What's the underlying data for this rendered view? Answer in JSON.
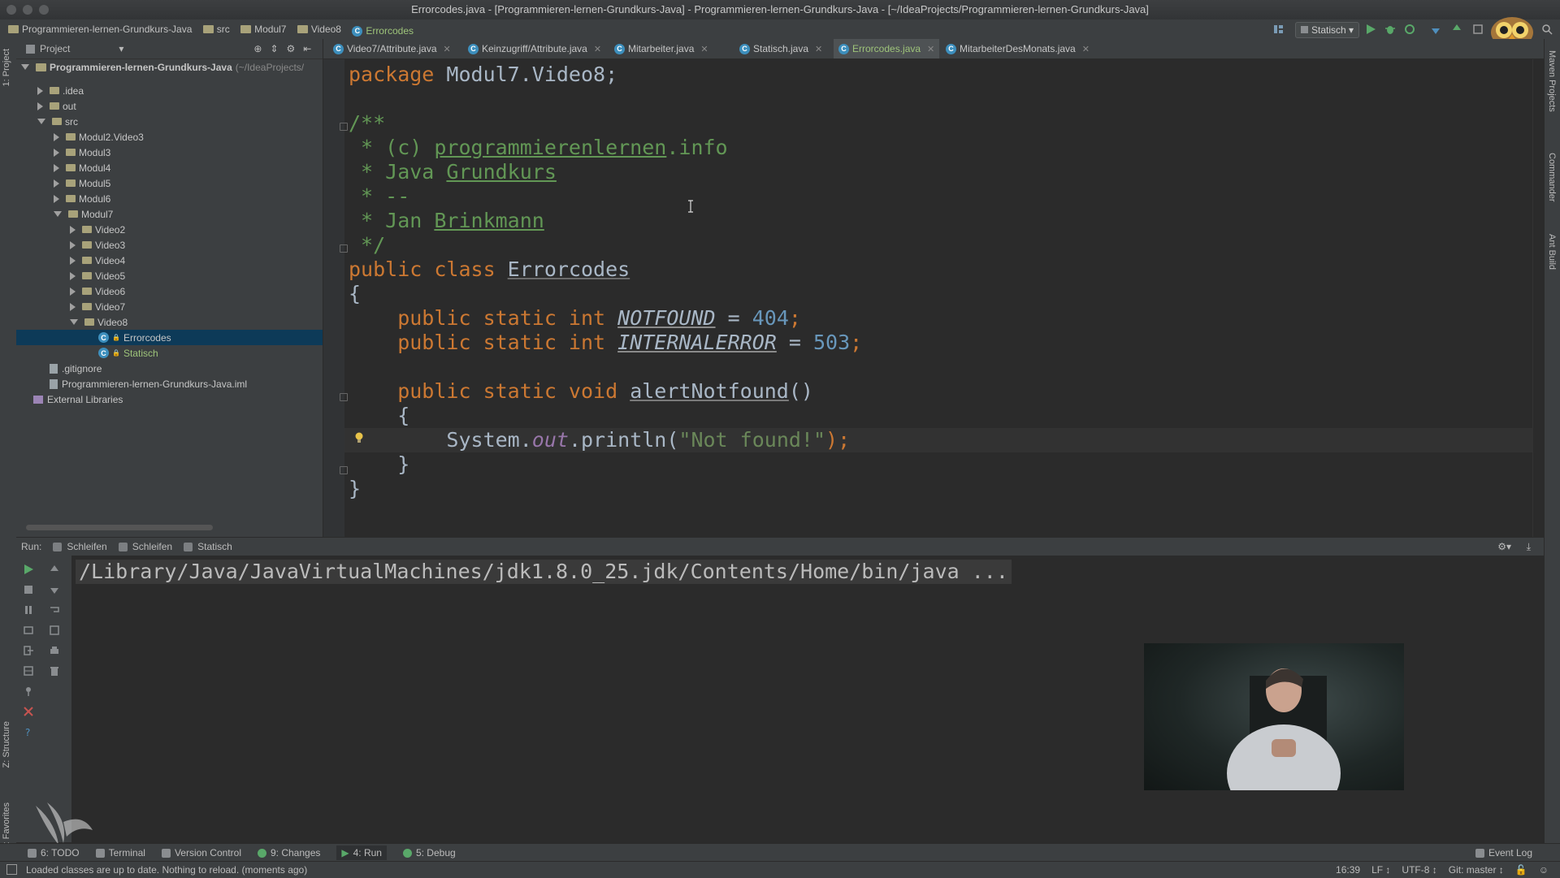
{
  "window": {
    "title": "Errorcodes.java - [Programmieren-lernen-Grundkurs-Java] - Programmieren-lernen-Grundkurs-Java - [~/IdeaProjects/Programmieren-lernen-Grundkurs-Java]"
  },
  "navbar": {
    "crumbs": [
      "Programmieren-lernen-Grundkurs-Java",
      "src",
      "Modul7",
      "Video8",
      "Errorcodes"
    ],
    "run_config": "Statisch"
  },
  "left_strip": {
    "project": "1: Project",
    "structure": "Z: Structure",
    "favorites": "2: Favorites"
  },
  "right_strip": {
    "maven": "Maven Projects",
    "commander": "Commander",
    "ant": "Ant Build"
  },
  "project_panel": {
    "header": "Project",
    "root": "Programmieren-lernen-Grundkurs-Java",
    "root_path": "(~/IdeaProjects/",
    "tree": [
      {
        "label": ".idea",
        "level": 1,
        "state": "collapsed",
        "type": "folder"
      },
      {
        "label": "out",
        "level": 1,
        "state": "collapsed",
        "type": "folder"
      },
      {
        "label": "src",
        "level": 1,
        "state": "expanded",
        "type": "folder"
      },
      {
        "label": "Modul2.Video3",
        "level": 2,
        "state": "collapsed",
        "type": "folder"
      },
      {
        "label": "Modul3",
        "level": 2,
        "state": "collapsed",
        "type": "folder"
      },
      {
        "label": "Modul4",
        "level": 2,
        "state": "collapsed",
        "type": "folder"
      },
      {
        "label": "Modul5",
        "level": 2,
        "state": "collapsed",
        "type": "folder"
      },
      {
        "label": "Modul6",
        "level": 2,
        "state": "collapsed",
        "type": "folder"
      },
      {
        "label": "Modul7",
        "level": 2,
        "state": "expanded",
        "type": "folder"
      },
      {
        "label": "Video2",
        "level": 3,
        "state": "collapsed",
        "type": "folder"
      },
      {
        "label": "Video3",
        "level": 3,
        "state": "collapsed",
        "type": "folder"
      },
      {
        "label": "Video4",
        "level": 3,
        "state": "collapsed",
        "type": "folder"
      },
      {
        "label": "Video5",
        "level": 3,
        "state": "collapsed",
        "type": "folder"
      },
      {
        "label": "Video6",
        "level": 3,
        "state": "collapsed",
        "type": "folder"
      },
      {
        "label": "Video7",
        "level": 3,
        "state": "collapsed",
        "type": "folder"
      },
      {
        "label": "Video8",
        "level": 3,
        "state": "expanded",
        "type": "folder"
      },
      {
        "label": "Errorcodes",
        "level": 4,
        "state": "leaf",
        "type": "class",
        "selected": true
      },
      {
        "label": "Statisch",
        "level": 4,
        "state": "leaf",
        "type": "class"
      },
      {
        "label": ".gitignore",
        "level": 1,
        "state": "leaf",
        "type": "file"
      },
      {
        "label": "Programmieren-lernen-Grundkurs-Java.iml",
        "level": 1,
        "state": "leaf",
        "type": "iml"
      },
      {
        "label": "External Libraries",
        "level": 0,
        "state": "leaf",
        "type": "lib"
      }
    ]
  },
  "editor_tabs": [
    {
      "label": "Video7/Attribute.java",
      "active": false
    },
    {
      "label": "Keinzugriff/Attribute.java",
      "active": false
    },
    {
      "label": "Mitarbeiter.java",
      "active": false
    },
    {
      "label": "Statisch.java",
      "active": false
    },
    {
      "label": "Errorcodes.java",
      "active": true
    },
    {
      "label": "MitarbeiterDesMonats.java",
      "active": false
    }
  ],
  "code": {
    "pkg_kw": "package",
    "pkg_name": " Modul7.Video8;",
    "doc_open": "/**",
    "doc_c_prefix": " * (c) ",
    "doc_c_link": "programmierenlernen",
    "doc_c_suffix": ".info",
    "doc_java_prefix": " * Java ",
    "doc_java_word": "Grundkurs",
    "doc_dash": " * --",
    "doc_jan_prefix": " * Jan ",
    "doc_jan_word": "Brinkmann",
    "doc_close": " */",
    "class_kw": "public class ",
    "class_name": "Errorcodes",
    "brace_open": "{",
    "brace_close": "}",
    "f1_kw": "    public static int ",
    "f1_name": "NOTFOUND",
    "f1_eq": " = ",
    "f1_val": "404",
    "f1_end": ";",
    "f2_kw": "    public static int ",
    "f2_name": "INTERNALERROR",
    "f2_eq": " = ",
    "f2_val": "503",
    "f2_end": ";",
    "m_kw": "    public static void ",
    "m_name": "alertNotfound",
    "m_parens": "()",
    "m_open": "    {",
    "p_system": "        System.",
    "p_out": "out",
    "p_println": ".println(",
    "p_str": "\"Not found!\"",
    "p_end": ");",
    "m_close": "    }"
  },
  "run_panel": {
    "label": "Run:",
    "tabs": [
      "Schleifen",
      "Schleifen",
      "Statisch"
    ],
    "console_line": "/Library/Java/JavaVirtualMachines/jdk1.8.0_25.jdk/Contents/Home/bin/java ..."
  },
  "bottom_tabs": [
    "6: TODO",
    "Terminal",
    "Version Control",
    "9: Changes",
    "4: Run",
    "5: Debug"
  ],
  "event_log": "Event Log",
  "status": {
    "message": "Loaded classes are up to date. Nothing to reload. (moments ago)",
    "position": "16:39",
    "line_sep": "LF ↕",
    "encoding": "UTF-8 ↕",
    "vcs": "Git: master ↕"
  },
  "colors": {
    "keyword": "#cc7832",
    "comment": "#629755",
    "number": "#6897bb",
    "string": "#6a8759",
    "field": "#9876aa",
    "selection": "#0d3a58"
  }
}
